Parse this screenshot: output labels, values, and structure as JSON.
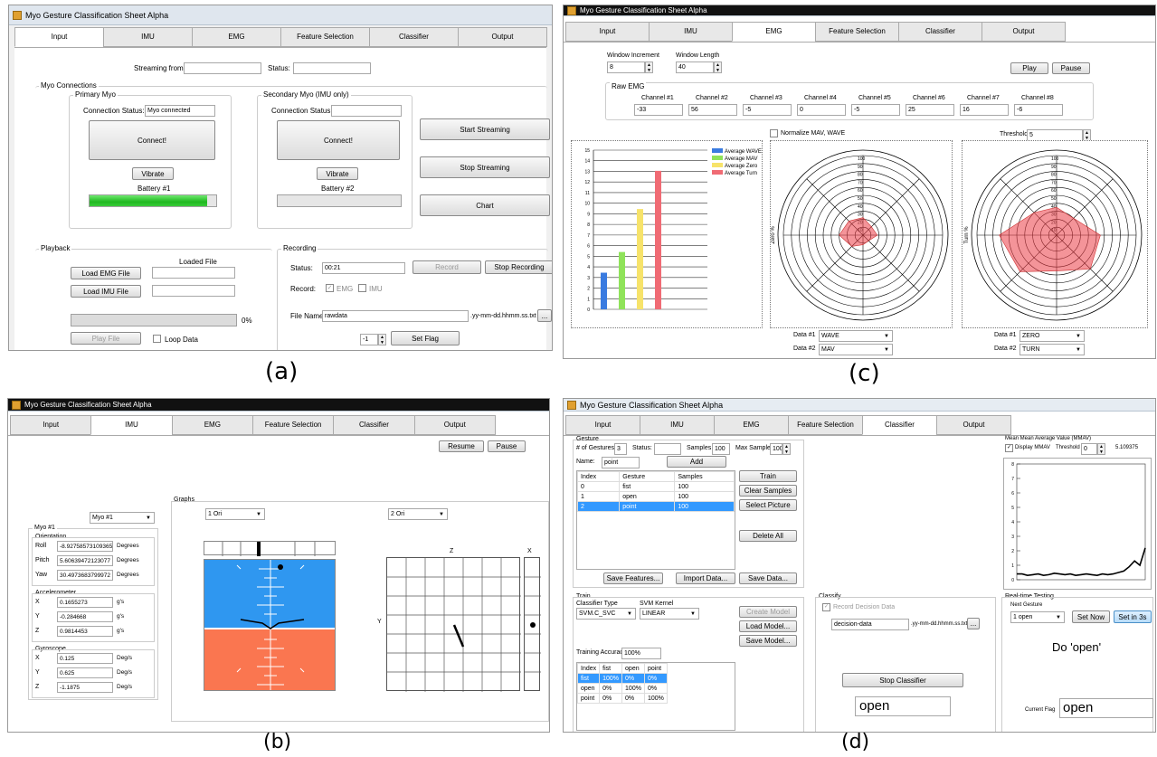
{
  "captions": {
    "a": "(a)",
    "b": "(b)",
    "c": "(c)",
    "d": "(d)"
  },
  "app_title": "Myo Gesture Classification Sheet Alpha",
  "tabs": [
    "Input",
    "IMU",
    "EMG",
    "Feature Selection",
    "Classifier",
    "Output"
  ],
  "panel_a": {
    "streaming_from_label": "Streaming from:",
    "streaming_from_value": "",
    "status_label": "Status:",
    "status_value": "",
    "myo_connections": "Myo Connections",
    "primary_myo": "Primary Myo",
    "conn_status_label": "Connection Status:",
    "primary_status": "Myo connected",
    "connect": "Connect!",
    "vibrate": "Vibrate",
    "battery1": "Battery #1",
    "battery1_level": 0.93,
    "secondary_myo": "Secondary Myo (IMU only)",
    "secondary_status": "",
    "battery2": "Battery #2",
    "battery2_level": 0,
    "start_streaming": "Start Streaming",
    "stop_streaming": "Stop Streaming",
    "chart": "Chart",
    "playback": "Playback",
    "loaded_file": "Loaded File",
    "load_emg": "Load EMG File",
    "load_imu": "Load IMU File",
    "playback_pct": "0%",
    "play_file": "Play File",
    "loop_data": "Loop Data",
    "recording": "Recording",
    "rec_status_label": "Status:",
    "rec_status": "00:21",
    "record": "Record",
    "stop_recording": "Stop Recording",
    "record_label": "Record:",
    "rec_emg": "EMG",
    "rec_imu": "IMU",
    "file_name_label": "File Name:",
    "file_name": "rawdata",
    "file_suffix": ".yy-mm-dd.hhmm.ss.txt",
    "browse": "...",
    "flag_value": "-1",
    "set_flag": "Set Flag"
  },
  "panel_b": {
    "resume": "Resume",
    "pause": "Pause",
    "myo_select": "Myo #1",
    "graphs": "Graphs",
    "graph1_select": "1 Ori",
    "graph2_select": "2 Ori",
    "myo_group": "Myo #1",
    "orientation": "Orientation",
    "orient_rows": [
      {
        "label": "Roll",
        "value": "-8.92758573109365",
        "unit": "Degrees"
      },
      {
        "label": "Pitch",
        "value": "5.60639472123077",
        "unit": "Degrees"
      },
      {
        "label": "Yaw",
        "value": "30.4973683799972",
        "unit": "Degrees"
      }
    ],
    "accelerometer": "Accelerometer",
    "accel_rows": [
      {
        "label": "X",
        "value": "0.1655273",
        "unit": "g's"
      },
      {
        "label": "Y",
        "value": "-0.284668",
        "unit": "g's"
      },
      {
        "label": "Z",
        "value": "0.9814453",
        "unit": "g's"
      }
    ],
    "gyroscope": "Gyroscope",
    "gyro_rows": [
      {
        "label": "X",
        "value": "0.125",
        "unit": "Deg/s"
      },
      {
        "label": "Y",
        "value": "0.625",
        "unit": "Deg/s"
      },
      {
        "label": "Z",
        "value": "-1.1875",
        "unit": "Deg/s"
      }
    ],
    "axis_z": "Z",
    "axis_x": "X",
    "axis_y": "Y"
  },
  "panel_c": {
    "window_increment_label": "Window Increment",
    "window_increment": "8",
    "window_length_label": "Window Length",
    "window_length": "40",
    "play": "Play",
    "pause": "Pause",
    "raw_emg": "Raw EMG",
    "channels": [
      {
        "name": "Channel #1",
        "value": "-33"
      },
      {
        "name": "Channel #2",
        "value": "56"
      },
      {
        "name": "Channel #3",
        "value": "-5"
      },
      {
        "name": "Channel #4",
        "value": "0"
      },
      {
        "name": "Channel #5",
        "value": "-5"
      },
      {
        "name": "Channel #6",
        "value": "25"
      },
      {
        "name": "Channel #7",
        "value": "16"
      },
      {
        "name": "Channel #8",
        "value": "-6"
      }
    ],
    "normalize_label": "Normalize MAV, WAVE",
    "threshold_label": "Threshold",
    "threshold": "5",
    "data1_label": "Data #1",
    "data2_label": "Data #2",
    "left_data1": "WAVE",
    "left_data2": "MAV",
    "right_data1": "ZERO",
    "right_data2": "TURN",
    "radar_left_axis": "Zero %",
    "radar_right_axis": "Turn %"
  },
  "panel_d": {
    "gesture": "Gesture",
    "num_gestures_label": "# of Gestures",
    "num_gestures": "3",
    "status_label": "Status:",
    "status_value": "",
    "samples_label": "Samples",
    "samples": "100",
    "max_samples_label": "Max Samples",
    "max_samples": "100",
    "name_label": "Name:",
    "name_value": "point",
    "add": "Add",
    "table_headers": [
      "Index",
      "Gesture",
      "Samples"
    ],
    "table_rows": [
      [
        "0",
        "fist",
        "100"
      ],
      [
        "1",
        "open",
        "100"
      ],
      [
        "2",
        "point",
        "100"
      ]
    ],
    "train": "Train",
    "clear_samples": "Clear Samples",
    "select_picture": "Select Picture",
    "delete_all": "Delete All",
    "save_features": "Save Features...",
    "import_data": "Import Data...",
    "save_data": "Save Data...",
    "train_group": "Train",
    "classifier_type_label": "Classifier Type",
    "classifier_type": "SVM.C_SVC",
    "svm_kernel_label": "SVM Kernel",
    "svm_kernel": "LINEAR",
    "create_model": "Create Model",
    "load_model": "Load Model...",
    "save_model": "Save Model...",
    "training_accuracy_label": "Training Accuracy:",
    "training_accuracy": "100%",
    "conf_headers": [
      "Index",
      "fist",
      "open",
      "point"
    ],
    "conf_rows": [
      [
        "fist",
        "100%",
        "0%",
        "0%"
      ],
      [
        "open",
        "0%",
        "100%",
        "0%"
      ],
      [
        "point",
        "0%",
        "0%",
        "100%"
      ]
    ],
    "classify": "Classify",
    "record_decision": "Record Decision Data",
    "decision_file": "decision-data",
    "decision_suffix": ".yy-mm-dd.hhmm.ss.txt",
    "browse": "...",
    "stop_classifier": "Stop Classifier",
    "classified": "open",
    "mmav_title": "Mean Mean Average Value (MMAV)",
    "display_mmav": "Display MMAV",
    "threshold_label": "Threshold",
    "threshold": "0",
    "mmav_value": "5.109375",
    "realtime": "Real-time Testing",
    "next_gesture_label": "Next Gesture",
    "next_gesture": "1 open",
    "set_now": "Set Now",
    "set_in_3s": "Set in 3s",
    "prompt": "Do 'open'",
    "current_flag_label": "Current Flag",
    "current_flag": "open"
  },
  "chart_data": [
    {
      "type": "bar",
      "series": [
        {
          "name": "Average WAVE",
          "values": [
            0.23
          ],
          "color": "#3a7be0"
        },
        {
          "name": "Average MAV",
          "values": [
            0.36
          ],
          "color": "#8fe35a"
        },
        {
          "name": "Average Zero",
          "values": [
            0.63
          ],
          "color": "#f7e36a"
        },
        {
          "name": "Average Turn",
          "values": [
            0.87
          ],
          "color": "#f06b74"
        }
      ],
      "yticks": [
        "0",
        "1",
        "2",
        "3",
        "4",
        "5",
        "6",
        "7",
        "8",
        "9",
        "10",
        "11",
        "12",
        "13",
        "14",
        "15"
      ],
      "legend": "top-right"
    },
    {
      "type": "radar",
      "rings": [
        "10",
        "20",
        "30",
        "40",
        "50",
        "60",
        "70",
        "80",
        "90",
        "100"
      ],
      "axis": "Zero %",
      "values": [
        22,
        15,
        18,
        10,
        12,
        20,
        30,
        25
      ]
    },
    {
      "type": "radar",
      "rings": [
        "10",
        "20",
        "30",
        "40",
        "50",
        "60",
        "70",
        "80",
        "90",
        "100"
      ],
      "axis": "Turn %",
      "values": [
        35,
        30,
        55,
        60,
        45,
        65,
        72,
        40
      ]
    },
    {
      "type": "line",
      "title": "Mean Mean Average Value (MMAV)",
      "yticks": [
        "0",
        "1",
        "2",
        "3",
        "4",
        "5",
        "6",
        "7",
        "8"
      ],
      "values": [
        0.4,
        0.4,
        0.3,
        0.35,
        0.4,
        0.3,
        0.35,
        0.45,
        0.4,
        0.35,
        0.4,
        0.3,
        0.35,
        0.4,
        0.35,
        0.3,
        0.4,
        0.35,
        0.4,
        0.5,
        0.6,
        0.9,
        1.3,
        1.0,
        2.2
      ]
    }
  ]
}
